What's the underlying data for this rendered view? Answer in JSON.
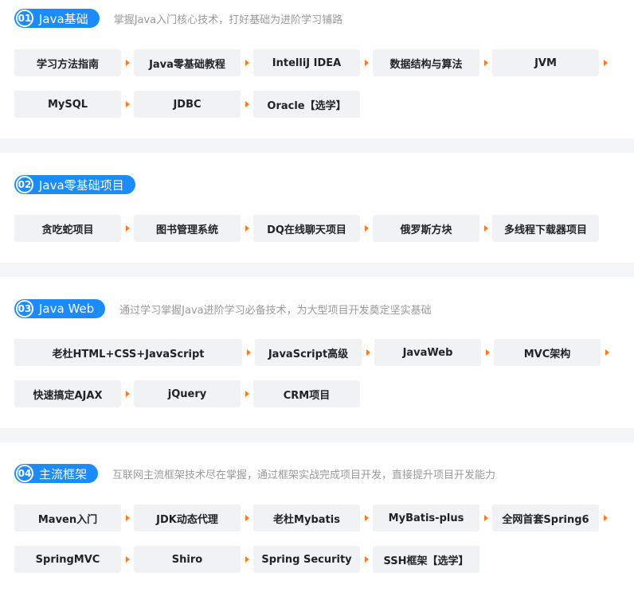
{
  "sections": [
    {
      "num": "01",
      "title": "Java基础",
      "desc": "掌握Java入门核心技术，打好基础为进阶学习铺路",
      "rows": [
        [
          "学习方法指南",
          "Java零基础教程",
          "IntelliJ IDEA",
          "数据结构与算法",
          "JVM"
        ],
        [
          "MySQL",
          "JDBC",
          "Oracle【选学】"
        ]
      ]
    },
    {
      "num": "02",
      "title": "Java零基础项目",
      "desc": "",
      "rows": [
        [
          "贪吃蛇项目",
          "图书管理系统",
          "DQ在线聊天项目",
          "俄罗斯方块",
          "多线程下载器项目"
        ]
      ]
    },
    {
      "num": "03",
      "title": "Java Web",
      "desc": "通过学习掌握Java进阶学习必备技术，为大型项目开发奠定坚实基础",
      "rows": [
        [
          "老杜HTML+CSS+JavaScript",
          "JavaScript高级",
          "JavaWeb",
          "MVC架构"
        ],
        [
          "快速搞定AJAX",
          "jQuery",
          "CRM项目"
        ]
      ]
    },
    {
      "num": "04",
      "title": "主流框架",
      "desc": "互联网主流框架技术尽在掌握，通过框架实战完成项目开发，直接提升项目开发能力",
      "rows": [
        [
          "Maven入门",
          "JDK动态代理",
          "老杜Mybatis",
          "MyBatis-plus",
          "全网首套Spring6"
        ],
        [
          "SpringMVC",
          "Shiro",
          "Spring Security",
          "SSH框架【选学】"
        ]
      ]
    }
  ],
  "colors": {
    "accent": "#1a8cff",
    "arrow": "#ff7a1a",
    "chip_bg": "#f1f2f4",
    "page_bg": "#f4f5f7"
  }
}
